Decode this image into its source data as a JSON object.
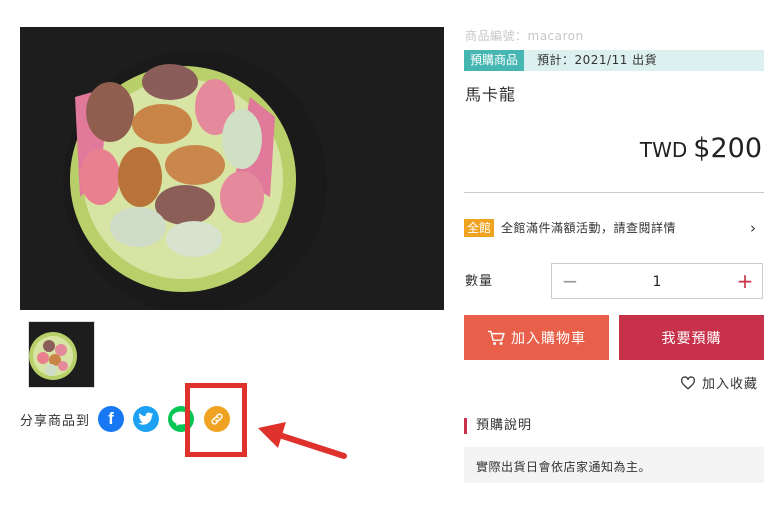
{
  "product": {
    "sku_text": "商品編號：macaron",
    "preorder_tag": "預購商品",
    "ship_text": "預計：2021/11 出貨",
    "name": "馬卡龍",
    "currency": "TWD",
    "price": "$200"
  },
  "promo": {
    "tag": "全館",
    "text": "全館滿件滿額活動，請查閱詳情",
    "chevron": "›"
  },
  "quantity": {
    "label": "數量",
    "value": "1",
    "minus": "−",
    "plus": "+"
  },
  "buttons": {
    "add_to_cart": "加入購物車",
    "preorder": "我要預購",
    "favorite": "加入收藏"
  },
  "share": {
    "label": "分享商品到",
    "icons": [
      "facebook-icon",
      "twitter-icon",
      "line-icon",
      "link-icon"
    ],
    "line_text": "LINE"
  },
  "note": {
    "title": "預購說明",
    "text": "實際出貨日會依店家通知為主。"
  },
  "colors": {
    "accent_red": "#c8314a",
    "cart_orange": "#e8604a",
    "teal": "#45b6b1",
    "promo_orange": "#f0a320",
    "highlight_red": "#e0322d"
  }
}
